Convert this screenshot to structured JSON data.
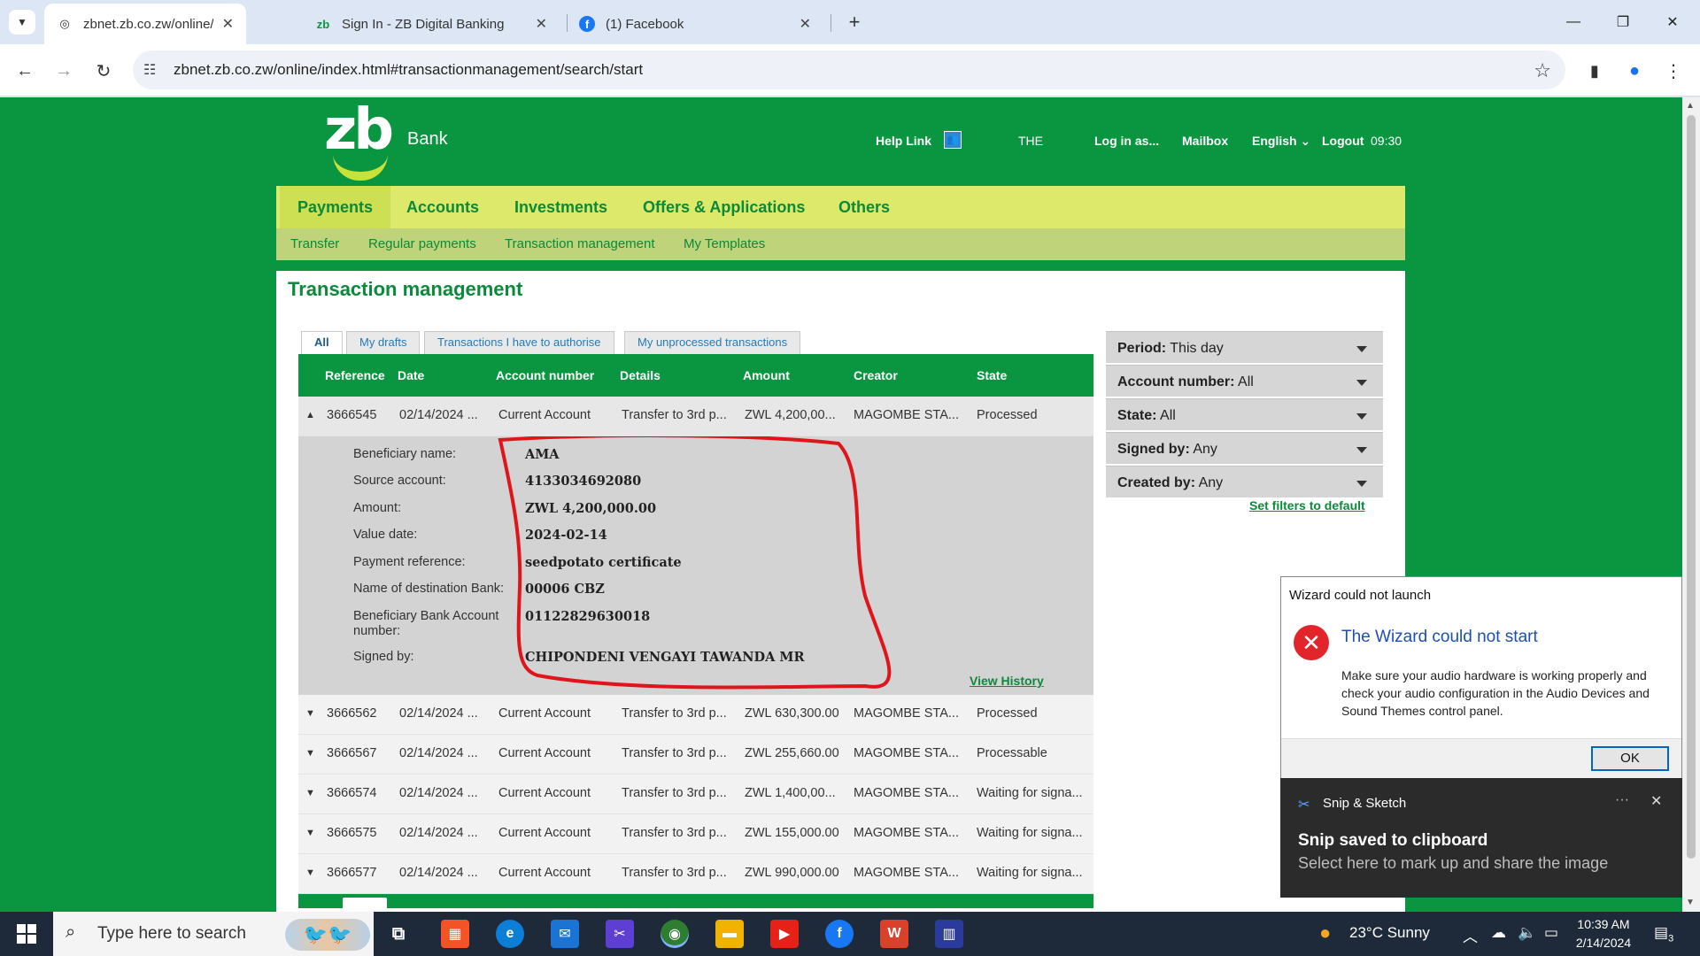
{
  "browser": {
    "tabs": [
      {
        "title": "zbnet.zb.co.zw/online/index.htm",
        "favicon": "globe-icon",
        "active": true
      },
      {
        "title": "Sign In - ZB Digital Banking",
        "favicon": "zb-icon",
        "active": false
      },
      {
        "title": "(1) Facebook",
        "favicon": "facebook-icon",
        "active": false
      }
    ],
    "url": "zbnet.zb.co.zw/online/index.html#transactionmanagement/search/start"
  },
  "header": {
    "logo_text": "zb",
    "bank_label": "Bank",
    "help_link": "Help Link",
    "the_label": "THE",
    "log_in_as": "Log in as...",
    "mailbox": "Mailbox",
    "language": "English",
    "logout": "Logout",
    "session_time": "09:30"
  },
  "main_nav": [
    "Payments",
    "Accounts",
    "Investments",
    "Offers & Applications",
    "Others"
  ],
  "sub_nav": [
    "Transfer",
    "Regular payments",
    "Transaction management",
    "My Templates"
  ],
  "page": {
    "title": "Transaction management",
    "tabs": [
      "All",
      "My drafts",
      "Transactions I have to authorise",
      "My unprocessed transactions"
    ]
  },
  "table": {
    "columns": [
      "Reference",
      "Date",
      "Account number",
      "Details",
      "Amount",
      "Creator",
      "State"
    ],
    "rows": [
      {
        "ref": "3666545",
        "date": "02/14/2024 ...",
        "account": "Current Account",
        "details": "Transfer to 3rd p...",
        "amount": "ZWL 4,200,00...",
        "creator": "MAGOMBE STA...",
        "state": "Processed"
      },
      {
        "ref": "3666562",
        "date": "02/14/2024 ...",
        "account": "Current Account",
        "details": "Transfer to 3rd p...",
        "amount": "ZWL 630,300.00",
        "creator": "MAGOMBE STA...",
        "state": "Processed"
      },
      {
        "ref": "3666567",
        "date": "02/14/2024 ...",
        "account": "Current Account",
        "details": "Transfer to 3rd p...",
        "amount": "ZWL 255,660.00",
        "creator": "MAGOMBE STA...",
        "state": "Processable"
      },
      {
        "ref": "3666574",
        "date": "02/14/2024 ...",
        "account": "Current Account",
        "details": "Transfer to 3rd p...",
        "amount": "ZWL 1,400,00...",
        "creator": "MAGOMBE STA...",
        "state": "Waiting for signa..."
      },
      {
        "ref": "3666575",
        "date": "02/14/2024 ...",
        "account": "Current Account",
        "details": "Transfer to 3rd p...",
        "amount": "ZWL 155,000.00",
        "creator": "MAGOMBE STA...",
        "state": "Waiting for signa..."
      },
      {
        "ref": "3666577",
        "date": "02/14/2024 ...",
        "account": "Current Account",
        "details": "Transfer to 3rd p...",
        "amount": "ZWL 990,000.00",
        "creator": "MAGOMBE STA...",
        "state": "Waiting for signa..."
      }
    ],
    "detail": [
      {
        "label": "Beneficiary name:",
        "value": "AMA"
      },
      {
        "label": "Source account:",
        "value": "4133034692080"
      },
      {
        "label": "Amount:",
        "value": "ZWL 4,200,000.00"
      },
      {
        "label": "Value date:",
        "value": "2024-02-14"
      },
      {
        "label": "Payment reference:",
        "value": "seedpotato certificate"
      },
      {
        "label": "Name of destination Bank:",
        "value": "00006 CBZ"
      },
      {
        "label": "Beneficiary Bank Account number:",
        "value": "01122829630018"
      },
      {
        "label": "Signed by:",
        "value": "CHIPONDENI VENGAYI TAWANDA MR"
      }
    ],
    "view_history": "View History"
  },
  "filters": [
    {
      "label": "Period:",
      "value": "This day"
    },
    {
      "label": "Account number:",
      "value": "All"
    },
    {
      "label": "State:",
      "value": "All"
    },
    {
      "label": "Signed by:",
      "value": "Any"
    },
    {
      "label": "Created by:",
      "value": "Any"
    }
  ],
  "set_filters_default": "Set filters to default",
  "dialog": {
    "window_title": "Wizard could not launch",
    "heading": "The Wizard could not start",
    "message": "Make sure your audio hardware is working properly and check your audio configuration in the Audio Devices and Sound Themes control panel.",
    "ok": "OK"
  },
  "toast": {
    "app": "Snip & Sketch",
    "title": "Snip saved to clipboard",
    "body": "Select here to mark up and share the image"
  },
  "taskbar": {
    "search_placeholder": "Type here to search",
    "weather": "23°C  Sunny",
    "time": "10:39 AM",
    "date": "2/14/2024",
    "notification_count": "3"
  },
  "colors": {
    "brand_green": "#0a9640",
    "nav_yellow": "#dde96a",
    "subnav_olive": "#bfd37a",
    "annotation_red": "#e0151b"
  }
}
